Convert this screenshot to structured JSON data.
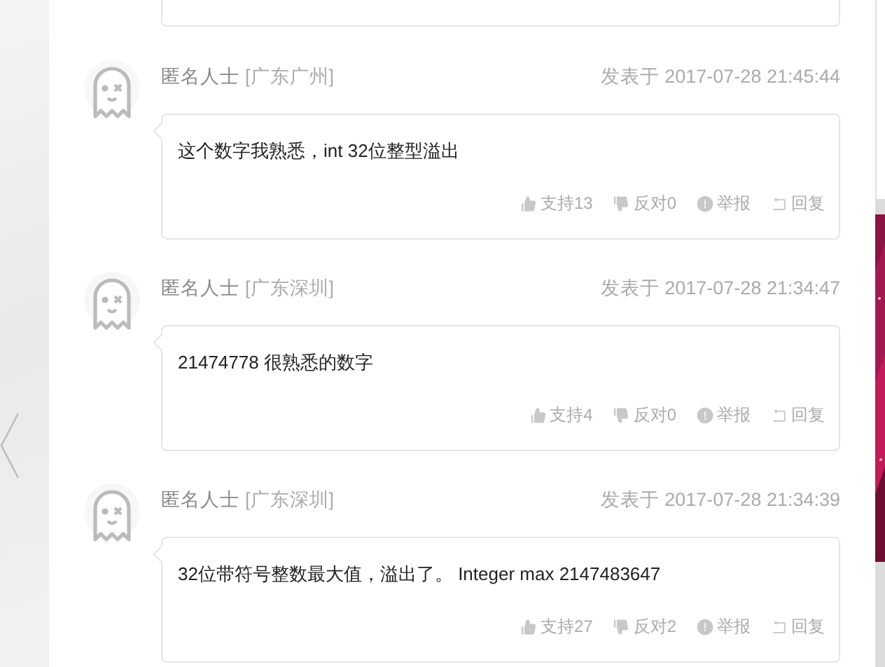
{
  "comments": [
    {
      "author": "匿名人士",
      "location": "[广东广州]",
      "time": "发表于 2017-07-28 21:45:44",
      "text": "这个数字我熟悉，int 32位整型溢出",
      "actions": [
        {
          "kind": "like",
          "label": "支持13"
        },
        {
          "kind": "dislike",
          "label": "反对0"
        },
        {
          "kind": "report",
          "label": "举报"
        },
        {
          "kind": "reply",
          "label": "回复"
        }
      ]
    },
    {
      "author": "匿名人士",
      "location": "[广东深圳]",
      "time": "发表于 2017-07-28 21:34:47",
      "text": "21474778 很熟悉的数字",
      "actions": [
        {
          "kind": "like",
          "label": "支持4"
        },
        {
          "kind": "dislike",
          "label": "反对0"
        },
        {
          "kind": "report",
          "label": "举报"
        },
        {
          "kind": "reply",
          "label": "回复"
        }
      ]
    },
    {
      "author": "匿名人士",
      "location": "[广东深圳]",
      "time": "发表于 2017-07-28 21:34:39",
      "text": "32位带符号整数最大值，溢出了。 Integer max 2147483647",
      "actions": [
        {
          "kind": "like",
          "label": "支持27"
        },
        {
          "kind": "dislike",
          "label": "反对2"
        },
        {
          "kind": "report",
          "label": "举报"
        },
        {
          "kind": "reply",
          "label": "回复"
        }
      ]
    }
  ]
}
